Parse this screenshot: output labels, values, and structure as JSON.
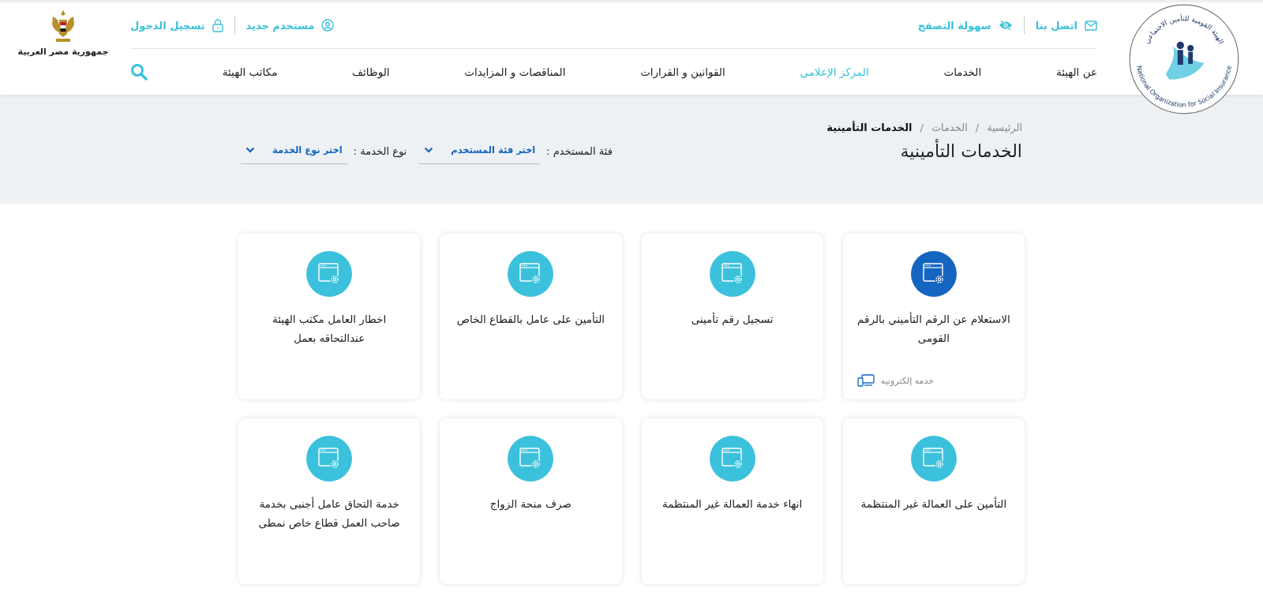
{
  "header": {
    "logo": {
      "ring_text_ar": "الهيئة القومية للتأمين الاجتماعي",
      "ring_text_en": "National Organization for Social Insurance"
    },
    "top_links_right": [
      {
        "label": "اتصل بنا",
        "kind": "mail"
      },
      {
        "label": "سهولة التصفح",
        "kind": "eye"
      }
    ],
    "top_links_left": [
      {
        "label": "مستخدم جديد",
        "kind": "user"
      },
      {
        "label": "تسجيل الدخول",
        "kind": "lock"
      }
    ],
    "nav": [
      {
        "label": "عن الهيئة",
        "selected": false
      },
      {
        "label": "الخدمات",
        "selected": false
      },
      {
        "label": "المركز الإعلامي",
        "selected": true
      },
      {
        "label": "القوانين و القرارات",
        "selected": false
      },
      {
        "label": "المناقصات و المزايدات",
        "selected": false
      },
      {
        "label": "الوظائف",
        "selected": false
      },
      {
        "label": "مكاتب الهيئة",
        "selected": false
      }
    ],
    "emblem_caption": "جمهورية مصر العربية"
  },
  "breadcrumb": [
    {
      "label": "الرئيسية",
      "current": false
    },
    {
      "label": "الخدمات",
      "current": false
    },
    {
      "label": "الخدمات التأمينية",
      "current": true
    }
  ],
  "breadcrumb_separator": "/",
  "page_title": "الخدمات التأمينية",
  "filters": [
    {
      "label": "فئة المستخدم :",
      "value": "اختر فئة المستخدم"
    },
    {
      "label": "نوع الخدمة :",
      "value": "اختر نوع الخدمة"
    }
  ],
  "services": [
    {
      "title": "الاستعلام عن الرقم التأميني بالرقم القومى",
      "highlighted": true,
      "e_service": "خدمه إلكترونيه"
    },
    {
      "title": "تسجيل رقم تأمينى",
      "highlighted": false
    },
    {
      "title": "التأمين على عامل بالقطاع الخاص",
      "highlighted": false
    },
    {
      "title": "اخطار العامل مكتب الهيئة عندالتحاقه بعمل",
      "highlighted": false
    },
    {
      "title": "التأمين على العمالة غير المنتظمة",
      "highlighted": false
    },
    {
      "title": "انهاء خدمة العمالة غير المنتظمة",
      "highlighted": false
    },
    {
      "title": "صرف منحة الزواج",
      "highlighted": false
    },
    {
      "title": "خدمة التحاق عامل أجنبى بخدمة صاحب العمل قطاع خاص نمطى",
      "highlighted": false
    }
  ]
}
